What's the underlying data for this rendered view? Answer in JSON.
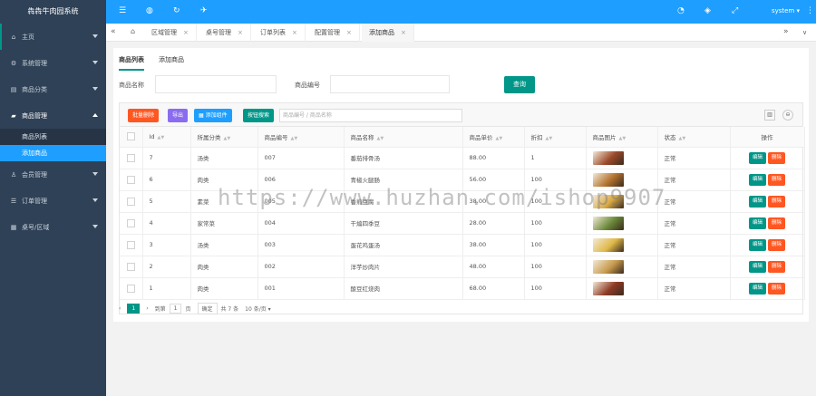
{
  "app": {
    "title": "犇犇牛肉园系统"
  },
  "sidebar": {
    "items": [
      {
        "label": "主页",
        "icon": "home-icon"
      },
      {
        "label": "系统管理",
        "icon": "gear-icon"
      },
      {
        "label": "商品分类",
        "icon": "category-icon"
      },
      {
        "label": "商品管理",
        "icon": "goods-icon"
      },
      {
        "label": "会员管理",
        "icon": "user-icon"
      },
      {
        "label": "订单管理",
        "icon": "order-icon"
      },
      {
        "label": "桌号/区域",
        "icon": "table-icon"
      }
    ],
    "sub_items": [
      {
        "label": "商品列表"
      },
      {
        "label": "添加商品"
      }
    ]
  },
  "topbar": {
    "user": "system"
  },
  "tabs": [
    {
      "label": "区域管理"
    },
    {
      "label": "桌号管理"
    },
    {
      "label": "订单列表"
    },
    {
      "label": "配置管理"
    },
    {
      "label": "添加商品"
    }
  ],
  "page": {
    "sub_tabs": [
      "商品列表",
      "添加商品"
    ],
    "search": {
      "name_label": "商品名称",
      "code_label": "商品编号",
      "query_button": "查询"
    },
    "toolbar": {
      "batch_delete": "批量删除",
      "export": "导出",
      "add": "添加组件",
      "refresh": "按钮搜索",
      "search_placeholder": "商品编号 / 商品名称"
    },
    "columns": [
      "Id",
      "所属分类",
      "商品编号",
      "商品名称",
      "商品单价",
      "折扣",
      "商品图片",
      "状态",
      "操作"
    ],
    "rows": [
      {
        "id": "7",
        "category": "汤类",
        "code": "007",
        "name": "番茄排骨汤",
        "price": "88.00",
        "discount": "1",
        "status": "正常",
        "color": "#9c4a2b"
      },
      {
        "id": "6",
        "category": "肉类",
        "code": "006",
        "name": "青椒火腿肠",
        "price": "56.00",
        "discount": "100",
        "status": "正常",
        "color": "#b3722e"
      },
      {
        "id": "5",
        "category": "素菜",
        "code": "005",
        "name": "香煎豆腐",
        "price": "38.00",
        "discount": "100",
        "status": "正常",
        "color": "#d9a842"
      },
      {
        "id": "4",
        "category": "家常菜",
        "code": "004",
        "name": "干煸四季豆",
        "price": "28.00",
        "discount": "100",
        "status": "正常",
        "color": "#6b8a3a"
      },
      {
        "id": "3",
        "category": "汤类",
        "code": "003",
        "name": "蛋花鸡蛋汤",
        "price": "38.00",
        "discount": "100",
        "status": "正常",
        "color": "#e0b94a"
      },
      {
        "id": "2",
        "category": "肉类",
        "code": "002",
        "name": "洋芋炒肉片",
        "price": "48.00",
        "discount": "100",
        "status": "正常",
        "color": "#c79a4e"
      },
      {
        "id": "1",
        "category": "肉类",
        "code": "001",
        "name": "酸豆红烧肉",
        "price": "68.00",
        "discount": "100",
        "status": "正常",
        "color": "#8e3b25"
      }
    ],
    "actions": {
      "edit": "编辑",
      "delete": "删除"
    },
    "pager": {
      "current": "1",
      "goto": "到第",
      "page_input": "1",
      "page_unit": "页",
      "confirm": "确定",
      "total": "共 7 条",
      "per_page": "10 条/页"
    }
  },
  "watermark": "https://www.huzhan.com/ishop9907",
  "colors": {
    "primary": "#1e9fff",
    "green": "#009688",
    "sidebar": "#2f4156",
    "orange": "#ff5722"
  }
}
